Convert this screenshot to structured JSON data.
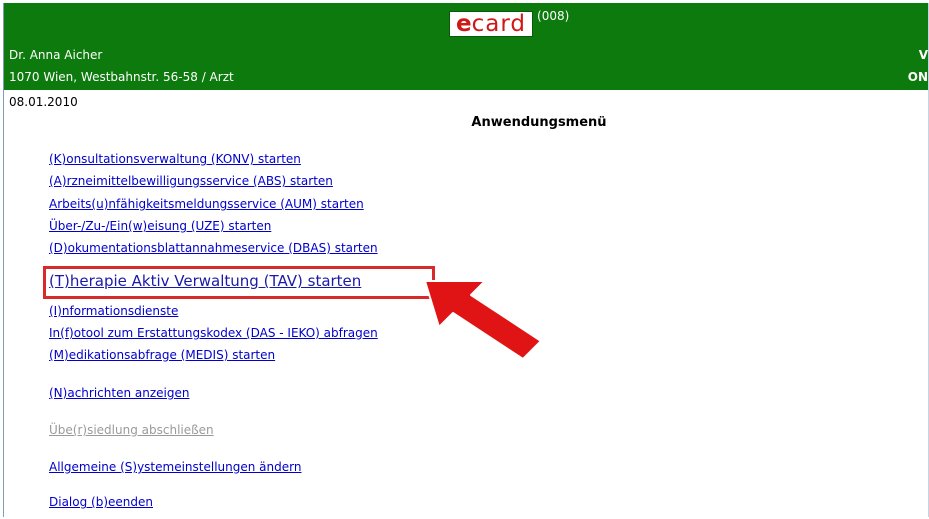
{
  "header": {
    "logo": {
      "brand": "ecard",
      "code": "(008)"
    },
    "doctor_name": "Dr. Anna Aicher",
    "address": "1070 Wien, Westbahnstr. 56-58 / Arzt",
    "right_top": "V",
    "right_bottom": "ON",
    "bg_color": "#0c7a0c"
  },
  "date": "08.01.2010",
  "menu": {
    "title": "Anwendungsmenü",
    "items": [
      {
        "label": "(K)onsultationsverwaltung (KONV) starten"
      },
      {
        "label": "(A)rzneimittelbewilligungsservice (ABS) starten"
      },
      {
        "label": "Arbeits(u)nfähigkeitsmeldungsservice (AUM) starten"
      },
      {
        "label": "Über-/Zu-/Ein(w)eisung (UZE) starten"
      },
      {
        "label": "(D)okumentationsblattannahmeservice (DBAS) starten"
      },
      {
        "label": "(T)herapie Aktiv Verwaltung (TAV) starten"
      },
      {
        "label": "(I)nformationsdienste"
      },
      {
        "label": "In(f)otool zum Erstattungskodex (DAS - IEKO) abfragen"
      },
      {
        "label": "(M)edikationsabfrage (MEDIS) starten"
      },
      {
        "label": "(N)achrichten anzeigen"
      },
      {
        "label": "Übe(r)siedlung abschließen"
      },
      {
        "label": "Allgemeine (S)ystemeinstellungen ändern"
      },
      {
        "label": "Dialog (b)eenden"
      }
    ]
  },
  "annotation": {
    "highlight_color": "#d82a2a",
    "arrow_icon": "red-arrow-pointing-up-left"
  }
}
